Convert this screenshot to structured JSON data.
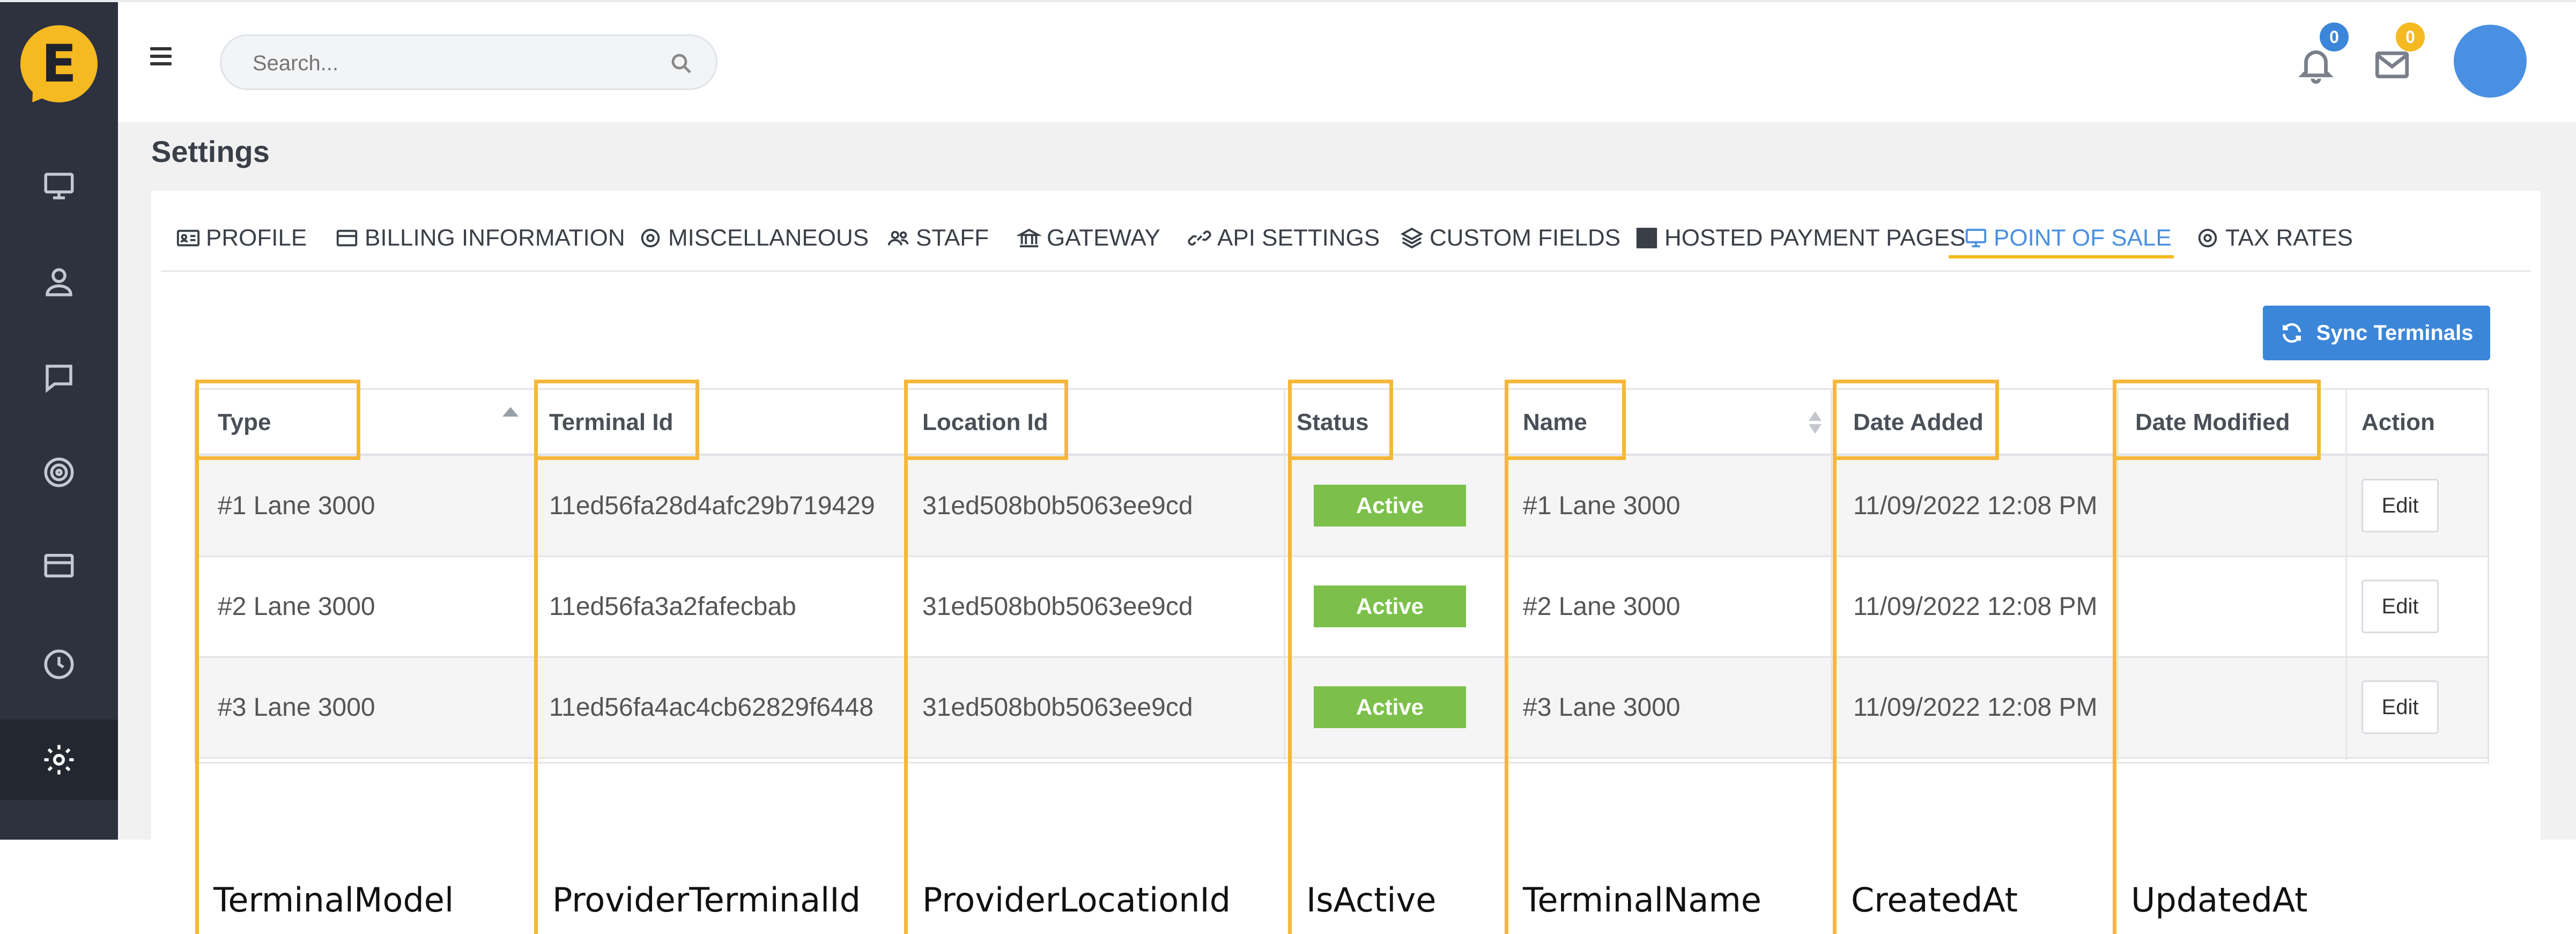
{
  "app": {
    "logo_letter": "E",
    "brand_color": "#f5b921",
    "accent_color": "#4a90e2"
  },
  "sidebar": {
    "items": [
      {
        "icon": "monitor-icon"
      },
      {
        "icon": "user-icon"
      },
      {
        "icon": "chat-icon"
      },
      {
        "icon": "target-icon"
      },
      {
        "icon": "credit-card-icon"
      },
      {
        "icon": "clock-icon"
      },
      {
        "icon": "gear-icon",
        "active": true
      }
    ]
  },
  "header": {
    "search_placeholder": "Search...",
    "notifications_count": "0",
    "messages_count": "0",
    "notification_badge_color": "#3b86d8",
    "message_badge_color": "#f5b921"
  },
  "page": {
    "title": "Settings"
  },
  "tabs": [
    {
      "label": "PROFILE",
      "icon": "id-card-icon"
    },
    {
      "label": "BILLING INFORMATION",
      "icon": "credit-card-icon"
    },
    {
      "label": "MISCELLANEOUS",
      "icon": "gear-icon"
    },
    {
      "label": "STAFF",
      "icon": "users-icon"
    },
    {
      "label": "GATEWAY",
      "icon": "bank-icon"
    },
    {
      "label": "API SETTINGS",
      "icon": "link-icon"
    },
    {
      "label": "CUSTOM FIELDS",
      "icon": "layers-icon"
    },
    {
      "label": "HOSTED PAYMENT PAGES",
      "icon": "grid-icon"
    },
    {
      "label": "POINT OF SALE",
      "icon": "monitor-icon",
      "active": true
    },
    {
      "label": "TAX RATES",
      "icon": "gear-icon"
    }
  ],
  "toolbar": {
    "sync_label": "Sync Terminals"
  },
  "table": {
    "columns": [
      "Type",
      "Terminal Id",
      "Location Id",
      "Status",
      "Name",
      "Date Added",
      "Date Modified",
      "Action"
    ],
    "rows": [
      {
        "type": "#1 Lane 3000",
        "terminal_id": "11ed56fa28d4afc29b719429",
        "location_id": "31ed508b0b5063ee9cd",
        "status": "Active",
        "name": "#1 Lane 3000",
        "date_added": "11/09/2022 12:08 PM",
        "date_modified": "",
        "action": "Edit"
      },
      {
        "type": "#2 Lane 3000",
        "terminal_id": "11ed56fa3a2fafecbab",
        "location_id": "31ed508b0b5063ee9cd",
        "status": "Active",
        "name": "#2 Lane 3000",
        "date_added": "11/09/2022 12:08 PM",
        "date_modified": "",
        "action": "Edit"
      },
      {
        "type": "#3 Lane 3000",
        "terminal_id": "11ed56fa4ac4cb62829f6448",
        "location_id": "31ed508b0b5063ee9cd",
        "status": "Active",
        "name": "#3 Lane 3000",
        "date_added": "11/09/2022 12:08 PM",
        "date_modified": "",
        "action": "Edit"
      }
    ]
  },
  "annotations": {
    "highlight_color": "#f5b73a",
    "labels": [
      "TerminalModel",
      "ProviderTerminalId",
      "ProviderLocationId",
      "IsActive",
      "TerminalName",
      "CreatedAt",
      "UpdatedAt"
    ]
  }
}
